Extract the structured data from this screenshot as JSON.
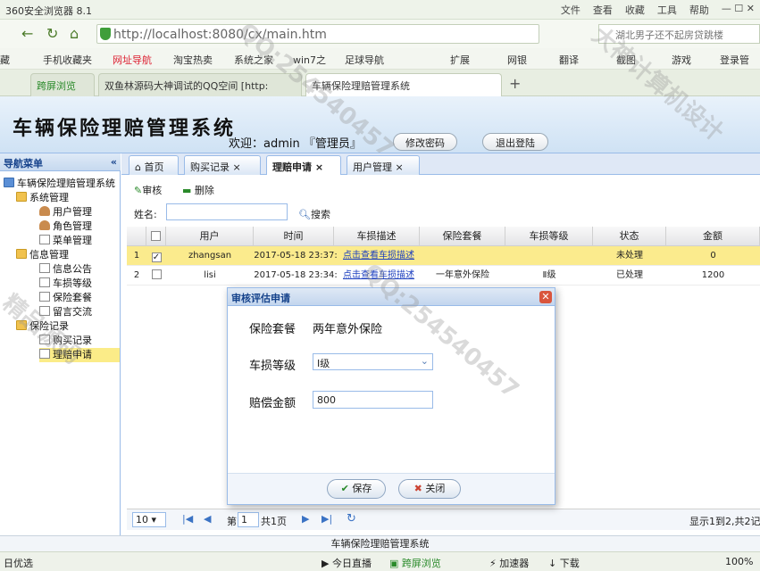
{
  "browser": {
    "title": "360安全浏览器 8.1",
    "menus": [
      "文件",
      "查看",
      "收藏",
      "工具",
      "帮助"
    ],
    "url": "http://localhost:8080/cx/main.htm",
    "search_placeholder": "湖北男子还不起房贷跳楼",
    "bookmarks": [
      "藏",
      "手机收藏夹",
      "网址导航",
      "淘宝热卖",
      "系统之家",
      "win7之",
      "足球导航",
      "扩展",
      "网银",
      "翻译",
      "截图",
      "游戏",
      "登录管"
    ],
    "tabs": [
      "跨屏浏览",
      "双鱼林源码大神调试的QQ空间 [http:",
      "车辆保险理赔管理系统"
    ]
  },
  "app": {
    "title": "车辆保险理赔管理系统",
    "welcome": "欢迎：admin 『管理员』",
    "change_password": "修改密码",
    "logout": "退出登陆"
  },
  "sidebar": {
    "header": "导航菜单",
    "root": "车辆保险理赔管理系统",
    "groups": [
      {
        "label": "系统管理",
        "items": [
          "用户管理",
          "角色管理",
          "菜单管理"
        ]
      },
      {
        "label": "信息管理",
        "items": [
          "信息公告",
          "车损等级",
          "保险套餐",
          "留言交流"
        ]
      },
      {
        "label": "保险记录",
        "items": [
          "购买记录",
          "理赔申请"
        ]
      }
    ]
  },
  "content_tabs": [
    "首页",
    "购买记录",
    "理赔申请",
    "用户管理"
  ],
  "toolbar": {
    "audit": "审核",
    "delete": "删除"
  },
  "filter": {
    "label": "姓名:",
    "search": "搜索"
  },
  "grid": {
    "columns": [
      "用户",
      "时间",
      "车损描述",
      "保险套餐",
      "车损等级",
      "状态",
      "金额"
    ],
    "rows": [
      {
        "num": "1",
        "checked": true,
        "user": "zhangsan",
        "time": "2017-05-18 23:37:",
        "desc": "点击查看车损描述",
        "package": "",
        "level": "",
        "status": "未处理",
        "amount": "0"
      },
      {
        "num": "2",
        "checked": false,
        "user": "lisi",
        "time": "2017-05-18 23:34:",
        "desc": "点击查看车损描述",
        "package": "一年意外保险",
        "level": "Ⅱ级",
        "status": "已处理",
        "amount": "1200"
      }
    ]
  },
  "pager": {
    "page_size": "10",
    "page_prefix": "第",
    "page": "1",
    "page_suffix": "共1页",
    "info": "显示1到2,共2记录"
  },
  "footer": "车辆保险理赔管理系统",
  "statusbar": {
    "left": "日优选",
    "items": [
      "今日直播",
      "跨屏浏览",
      "加速器",
      "下载",
      "100%"
    ]
  },
  "dialog": {
    "title": "审核评估申请",
    "package_label": "保险套餐",
    "package_value": "两年意外保险",
    "level_label": "车损等级",
    "level_value": "Ⅰ级",
    "amount_label": "赔偿金额",
    "amount_value": "800",
    "save": "保存",
    "close": "关闭"
  },
  "watermarks": [
    "QQ:254540457",
    "大神计算机设计",
    "精品源码"
  ]
}
